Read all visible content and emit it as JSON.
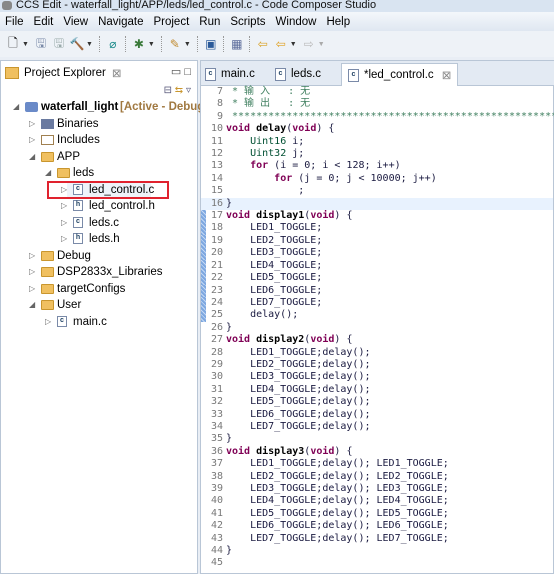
{
  "window": {
    "title": "CCS Edit - waterfall_light/APP/leds/led_control.c - Code Composer Studio"
  },
  "menu": [
    "File",
    "Edit",
    "View",
    "Navigate",
    "Project",
    "Run",
    "Scripts",
    "Window",
    "Help"
  ],
  "toolbar_icons": [
    "new-icon",
    "save-icon",
    "save-all-icon",
    "build-hammer-icon",
    "search-icon",
    "debug-bug-icon",
    "flash-icon",
    "terminal-icon",
    "view-icon",
    "last-edit-icon",
    "back-arrow-icon",
    "forward-arrow-icon"
  ],
  "explorer": {
    "title": "Project Explorer",
    "project": {
      "name": "waterfall_light",
      "status": "[Active - Debug]"
    },
    "items": [
      {
        "label": "Binaries",
        "icon": "binaries",
        "level": 1,
        "expanded": false
      },
      {
        "label": "Includes",
        "icon": "includes",
        "level": 1,
        "expanded": false
      },
      {
        "label": "APP",
        "icon": "folder",
        "level": 1,
        "expanded": true
      },
      {
        "label": "leds",
        "icon": "folder",
        "level": 2,
        "expanded": true
      },
      {
        "label": "led_control.c",
        "icon": "c-file",
        "level": 3,
        "expanded": false,
        "highlighted": true
      },
      {
        "label": "led_control.h",
        "icon": "h-file",
        "level": 3,
        "expanded": false
      },
      {
        "label": "leds.c",
        "icon": "c-file",
        "level": 3,
        "expanded": false
      },
      {
        "label": "leds.h",
        "icon": "h-file",
        "level": 3,
        "expanded": false
      },
      {
        "label": "Debug",
        "icon": "folder",
        "level": 1,
        "expanded": false
      },
      {
        "label": "DSP2833x_Libraries",
        "icon": "folder",
        "level": 1,
        "expanded": false
      },
      {
        "label": "targetConfigs",
        "icon": "folder",
        "level": 1,
        "expanded": false
      },
      {
        "label": "User",
        "icon": "folder",
        "level": 1,
        "expanded": true
      },
      {
        "label": "main.c",
        "icon": "c-file",
        "level": 2,
        "expanded": false
      }
    ]
  },
  "editor": {
    "tabs": [
      {
        "label": "main.c"
      },
      {
        "label": "leds.c"
      },
      {
        "label": "*led_control.c",
        "active": true
      }
    ],
    "lines": [
      {
        "n": "7",
        "t": " * 输 入   : 无"
      },
      {
        "n": "8",
        "t": " * 输 出   : 无"
      },
      {
        "n": "9",
        "t": " ******************************************************"
      },
      {
        "n": "10",
        "t": "void delay(void) {"
      },
      {
        "n": "11",
        "t": "    Uint16 i;"
      },
      {
        "n": "12",
        "t": "    Uint32 j;"
      },
      {
        "n": "13",
        "t": "    for (i = 0; i < 128; i++)"
      },
      {
        "n": "14",
        "t": "        for (j = 0; j < 10000; j++)"
      },
      {
        "n": "15",
        "t": "            ;"
      },
      {
        "n": "16",
        "t": "}"
      },
      {
        "n": "17",
        "t": "void display1(void) {"
      },
      {
        "n": "18",
        "t": "    LED1_TOGGLE;"
      },
      {
        "n": "19",
        "t": "    LED2_TOGGLE;"
      },
      {
        "n": "20",
        "t": "    LED3_TOGGLE;"
      },
      {
        "n": "21",
        "t": "    LED4_TOGGLE;"
      },
      {
        "n": "22",
        "t": "    LED5_TOGGLE;"
      },
      {
        "n": "23",
        "t": "    LED6_TOGGLE;"
      },
      {
        "n": "24",
        "t": "    LED7_TOGGLE;"
      },
      {
        "n": "25",
        "t": "    delay();"
      },
      {
        "n": "26",
        "t": "}"
      },
      {
        "n": "27",
        "t": "void display2(void) {"
      },
      {
        "n": "28",
        "t": "    LED1_TOGGLE;delay();"
      },
      {
        "n": "29",
        "t": "    LED2_TOGGLE;delay();"
      },
      {
        "n": "30",
        "t": "    LED3_TOGGLE;delay();"
      },
      {
        "n": "31",
        "t": "    LED4_TOGGLE;delay();"
      },
      {
        "n": "32",
        "t": "    LED5_TOGGLE;delay();"
      },
      {
        "n": "33",
        "t": "    LED6_TOGGLE;delay();"
      },
      {
        "n": "34",
        "t": "    LED7_TOGGLE;delay();"
      },
      {
        "n": "35",
        "t": "}"
      },
      {
        "n": "36",
        "t": "void display3(void) {"
      },
      {
        "n": "37",
        "t": "    LED1_TOGGLE;delay(); LED1_TOGGLE;"
      },
      {
        "n": "38",
        "t": "    LED2_TOGGLE;delay(); LED2_TOGGLE;"
      },
      {
        "n": "39",
        "t": "    LED3_TOGGLE;delay(); LED3_TOGGLE;"
      },
      {
        "n": "40",
        "t": "    LED4_TOGGLE;delay(); LED4_TOGGLE;"
      },
      {
        "n": "41",
        "t": "    LED5_TOGGLE;delay(); LED5_TOGGLE;"
      },
      {
        "n": "42",
        "t": "    LED6_TOGGLE;delay(); LED6_TOGGLE;"
      },
      {
        "n": "43",
        "t": "    LED7_TOGGLE;delay(); LED7_TOGGLE;"
      },
      {
        "n": "44",
        "t": "}"
      },
      {
        "n": "45",
        "t": ""
      }
    ],
    "changed_lines": [
      "17",
      "18",
      "19",
      "20",
      "21",
      "22",
      "23",
      "24",
      "25"
    ],
    "current_line": "16"
  },
  "colors": {
    "keyword": "#7f0055",
    "type": "#005032",
    "comment": "#3f7f5f",
    "highlight_box": "#e0222e"
  }
}
